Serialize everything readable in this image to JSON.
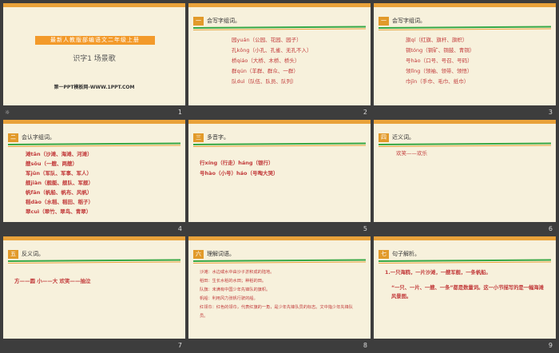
{
  "slides": [
    {
      "number": "1",
      "type": "title",
      "textbook": "最新人教版部编语文二年级上册",
      "lesson": "识字1 场景歌",
      "site": "第一PPT模板网-WWW.1PPT.COM"
    },
    {
      "number": "2",
      "badge": "一",
      "title": "会写字组词。",
      "lines": [
        "园yuán（公园、花园、园子）",
        "孔kǒng（小孔、孔雀、无孔不入）",
        "桥qiáo（大桥、木桥、桥头）",
        "群qún（羊群、群众、一群）",
        "队duì（队伍、队员、队列）"
      ]
    },
    {
      "number": "3",
      "badge": "一",
      "title": "会写字组词。",
      "lines": [
        "旗qí（红旗、旗杆、旗帜）",
        "铜tóng（铜矿、铜鼓、青铜）",
        "号hào（口号、号召、号码）",
        "领lǐng（领袖、领带、领悟）",
        "巾jīn（手巾、毛巾、纸巾）"
      ]
    },
    {
      "number": "4",
      "badge": "二",
      "title": "会认字组词。",
      "lines": [
        "滩tān（沙滩、海滩、河滩）",
        "艘sōu（一艘、两艘）",
        "军jūn（军队、军事、军人）",
        "舰jiàn（舰艇、舰队、军舰）",
        "帆fān（帆船、帆布、风帆）",
        "稻dào（水稻、稻田、稻子）",
        "翠cuì（翠竹、翠鸟、青翠）"
      ]
    },
    {
      "number": "5",
      "badge": "三",
      "title": "多音字。",
      "lines": [
        "行xíng（行走）háng（银行）",
        "号hào（小号）háo（号啕大哭）"
      ]
    },
    {
      "number": "6",
      "badge": "四",
      "title": "近义词。",
      "lines": [
        "欢笑——欢乐"
      ]
    },
    {
      "number": "7",
      "badge": "五",
      "title": "反义词。",
      "lines": [
        "方——圆 小——大 欢笑——抽泣"
      ]
    },
    {
      "number": "8",
      "badge": "六",
      "title": "理解词语。",
      "lines": [
        "沙滩：水边或水中由沙子淤积成的陆地。",
        "稻田：生长水稻的水田；种稻的田。",
        "队旗：未满有中国少年先锋队的旗帜。",
        "帆船：利用风力张帆行驶的船。",
        "红领巾：红色的领巾，代表红旗的一角，是少年先锋队员的标志。文中指少年先锋队员。"
      ]
    },
    {
      "number": "9",
      "badge": "七",
      "title": "句子解析。",
      "lines": [
        "1.一只海鸥，一片沙滩，一艘军舰，一条帆船。",
        "“一只、一片、一艘、一条”都是数量词。这一小节描写的是一幅海滩风景图。"
      ]
    }
  ],
  "colors": {
    "slide_bg": "#f7f1dc",
    "accent_orange": "#e9a23a",
    "accent_green": "#36a844",
    "text_red": "#c23b3b"
  },
  "first_label_icon": "slide-transition-icon",
  "first_label_icon_glyph": "☼"
}
